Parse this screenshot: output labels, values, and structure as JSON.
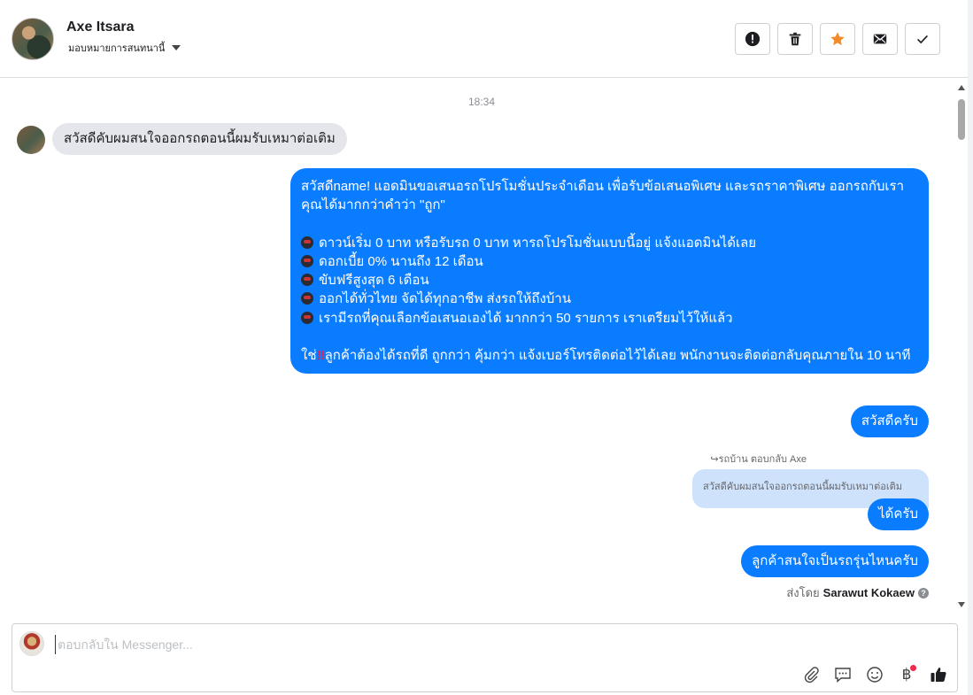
{
  "header": {
    "contact_name": "Axe Itsara",
    "assign_label": "มอบหมายการสนทนานี้"
  },
  "toolbar": {
    "icons": [
      "alert-icon",
      "trash-icon",
      "star-icon",
      "mail-icon",
      "check-icon"
    ],
    "accent": "#f28c28"
  },
  "conversation": {
    "timestamp": "18:34",
    "incoming_message": "สวัสดีคับผมสนใจออกรถตอนนี้ผมรับเหมาต่อเติม",
    "promo": {
      "intro": "สวัสดีname! แอดมินขอเสนอรถโปรโมชั่นประจำเดือน เพื่อรับข้อเสนอพิเศษ และรถราคาพิเศษ ออกรถกับเรา คุณได้มากกว่าคำว่า \"ถูก\"",
      "bullets": [
        "ดาวน์เริ่ม 0 บาท หรือรับรถ 0 บาท หารถโปรโมชั่นแบบนี้อยู่ แจ้งแอดมินได้เลย",
        "ดอกเบี้ย 0% นานถึง 12 เดือน",
        "ขับฟรีสูงสุด 6 เดือน",
        "ออกได้ทั่วไทย จัดได้ทุกอาชีพ ส่งรถให้ถึงบ้าน",
        "เรามีรถที่คุณเลือกข้อเสนอเองได้ มากกว่า 50 รายการ เราเตรียมไว้ให้แล้ว"
      ],
      "closing_prefix": "ใช่",
      "closing_mark": "‼",
      "closing_rest": "ลูกค้าต้องได้รถที่ดี ถูกกว่า คุ้มกว่า แจ้งเบอร์โทรติดต่อไว้ได้เลย พนักงานจะติดต่อกลับคุณภายใน 10 นาที"
    },
    "reply_greeting": "สวัสดีครับ",
    "reply_meta": "รถบ้าน ตอบกลับ Axe",
    "quoted_text": "สวัสดีคับผมสนใจออกรถตอนนี้ผมรับเหมาต่อเติม",
    "reply_ok": "ได้ครับ",
    "reply_question": "ลูกค้าสนใจเป็นรถรุ่นไหนครับ",
    "sent_by_prefix": "ส่งโดย",
    "sent_by_name": "Sarawut Kokaew",
    "outgoing_color": "#0a7cff",
    "incoming_color": "#e4e6eb"
  },
  "composer": {
    "placeholder": "ตอบกลับใน Messenger...",
    "icons": [
      "paperclip-icon",
      "saved-replies-icon",
      "emoji-icon",
      "baht-icon",
      "thumbs-up-icon"
    ]
  }
}
